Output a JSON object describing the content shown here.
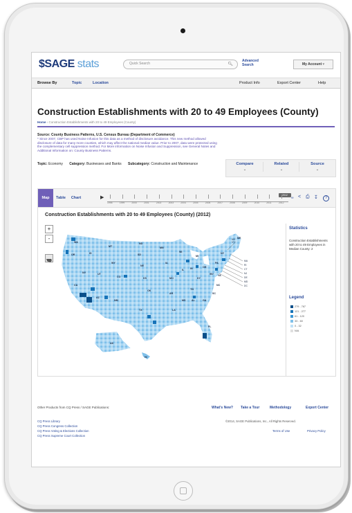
{
  "header": {
    "logo_brand": "SAGE",
    "logo_product": "stats",
    "search_placeholder": "Quick Search",
    "advanced_search": "Advanced Search",
    "my_account": "My Account"
  },
  "nav": {
    "browse_by": "Browse By",
    "topic": "Topic",
    "location": "Location",
    "product_info": "Product Info",
    "export_center": "Export Center",
    "help": "Help"
  },
  "page": {
    "title": "Construction Establishments with 20 to 49 Employees (County)",
    "breadcrumb_home": "Home",
    "breadcrumb_current": "Construction Establishments with 20 to 49 Employees (County)",
    "source": "Source: County Business Patterns, U.S. Census Bureau (Department of Commerce)",
    "note": "* Since 2007, CBP has used Noise Infusion for this data as a method of disclosure avoidance. This new method allowed disclosure of data for many more counties, which may affect the national median value. Prior to 2007, data were protected using the complementary cell suppression method. For More information on Noise Infusion and Suppression, see General Notes and Additional Information on: County Business Patterns.",
    "topic_label": "Topic:",
    "topic_value": "Economy",
    "category_label": "Category:",
    "category_value": "Businesses and Banks",
    "subcategory_label": "Subcategory:",
    "subcategory_value": "Construction and Maintenance"
  },
  "actions": {
    "compare": "Compare",
    "related": "Related",
    "source": "Source"
  },
  "viewer": {
    "tabs": [
      "Map",
      "Table",
      "Chart"
    ],
    "years": [
      "1998",
      "1999",
      "2000",
      "2001",
      "2002",
      "2003",
      "2004",
      "2005",
      "2006",
      "2007",
      "2008",
      "2009",
      "2010",
      "2011",
      "2012"
    ],
    "selected_year": "2012",
    "map_title": "Construction Establishments with 20 to 49 Employees (County) (2012)",
    "zoom_in": "+",
    "zoom_out": "-"
  },
  "map_labels": {
    "states": [
      "WA",
      "OR",
      "ID",
      "MT",
      "ND",
      "SD",
      "WY",
      "NE",
      "NV",
      "UT",
      "CO",
      "CA",
      "AZ",
      "NM",
      "KS",
      "OK",
      "TX",
      "MN",
      "IA",
      "MO",
      "AR",
      "LA",
      "WI",
      "IL",
      "MS",
      "AL",
      "TN",
      "KY",
      "IN",
      "OH",
      "MI",
      "GA",
      "FL",
      "SC",
      "NC",
      "VA",
      "WV",
      "PA",
      "NY",
      "ME",
      "AK",
      "HI"
    ],
    "callouts": [
      "NH",
      "VT",
      "MA",
      "RI",
      "CT",
      "NJ",
      "DE",
      "MD",
      "DC"
    ]
  },
  "sidebar": {
    "statistics_heading": "Statistics",
    "statistic_text": "Construction Establishments with 20 to 49 Employees in Median County: 2",
    "legend_heading": "Legend",
    "legend": [
      {
        "label": "279 - 767",
        "color": "#0b4f8a"
      },
      {
        "label": "121 - 277",
        "color": "#1673b8"
      },
      {
        "label": "61 - 120",
        "color": "#3c98d6"
      },
      {
        "label": "33 - 60",
        "color": "#7fc0ea"
      },
      {
        "label": "0 - 32",
        "color": "#bfe1f6"
      },
      {
        "label": "N/A",
        "color": "#e0e0e0"
      }
    ]
  },
  "footer": {
    "other_products": "Other Products from CQ Press / SAGE Publications:",
    "links": [
      "CQ Press Library",
      "CQ Press Congress Collection",
      "CQ Press Voting & Elections Collection",
      "CQ Press Supreme Court Collection"
    ],
    "whats_new": "What's New?",
    "take_tour": "Take a Tour",
    "methodology": "Methodology",
    "export_center": "Export Center",
    "copyright": "©2014, SAGE Publications, Inc., All Rights Reserved.",
    "terms": "Terms of Use",
    "privacy": "Privacy Policy"
  }
}
